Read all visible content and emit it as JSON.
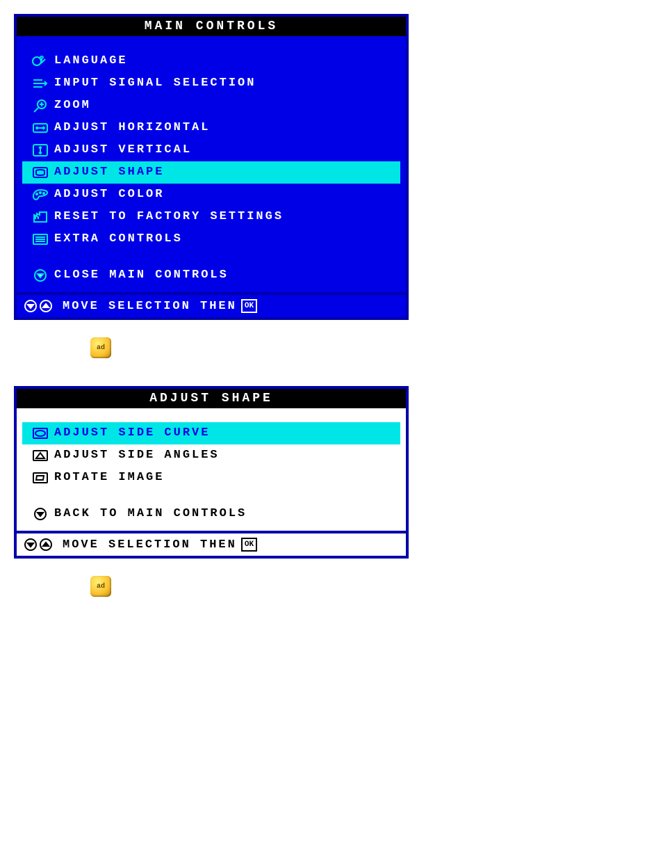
{
  "main": {
    "title": "MAIN CONTROLS",
    "items": [
      {
        "label": "LANGUAGE"
      },
      {
        "label": "INPUT SIGNAL SELECTION"
      },
      {
        "label": "ZOOM"
      },
      {
        "label": "ADJUST HORIZONTAL"
      },
      {
        "label": "ADJUST VERTICAL"
      },
      {
        "label": "ADJUST SHAPE"
      },
      {
        "label": "ADJUST COLOR"
      },
      {
        "label": "RESET TO FACTORY SETTINGS"
      },
      {
        "label": "EXTRA CONTROLS"
      }
    ],
    "close": "CLOSE MAIN CONTROLS",
    "footer": "MOVE SELECTION THEN",
    "ok": "OK"
  },
  "shape": {
    "title": "ADJUST SHAPE",
    "items": [
      {
        "label": "ADJUST SIDE CURVE"
      },
      {
        "label": "ADJUST SIDE ANGLES"
      },
      {
        "label": "ROTATE IMAGE"
      }
    ],
    "back": "BACK TO MAIN CONTROLS",
    "footer": "MOVE SELECTION THEN",
    "ok": "OK"
  },
  "button": {
    "label": "ad"
  }
}
